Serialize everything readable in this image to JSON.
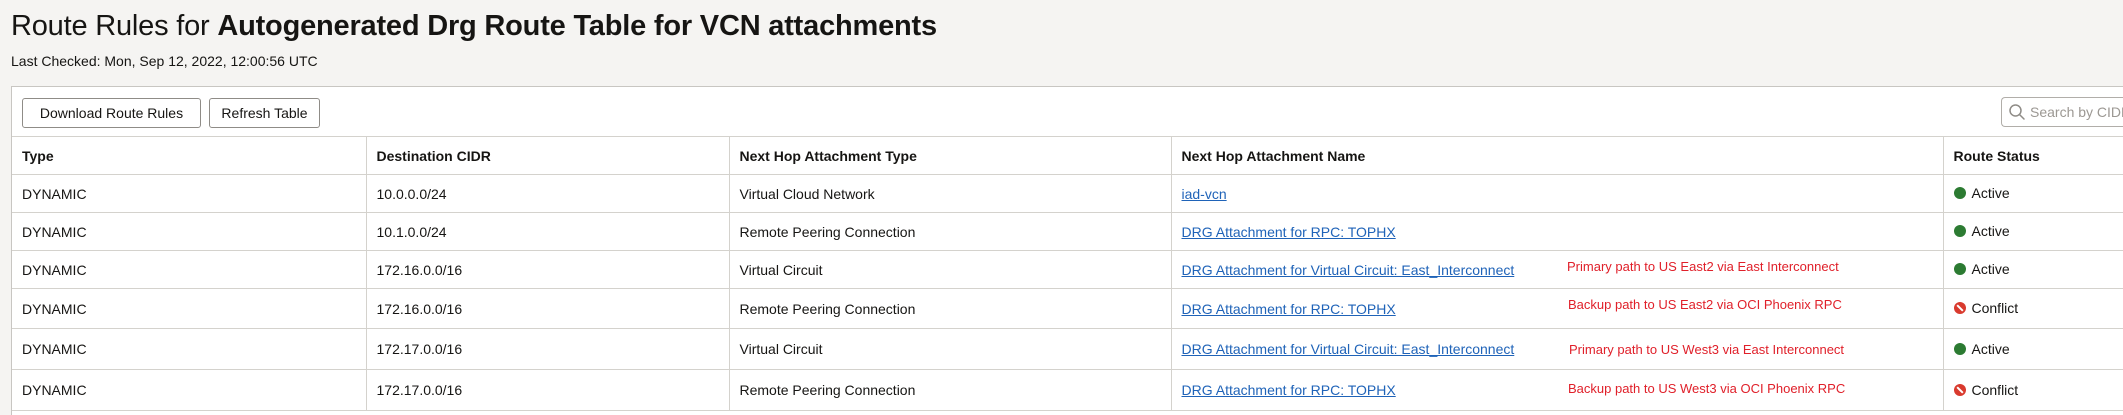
{
  "header": {
    "title_prefix": "Route Rules for ",
    "title_name": "Autogenerated Drg Route Table for VCN attachments",
    "last_checked": "Last Checked: Mon, Sep 12, 2022, 12:00:56 UTC"
  },
  "toolbar": {
    "download_label": "Download Route Rules",
    "refresh_label": "Refresh Table",
    "search_placeholder": "Search by CIDR"
  },
  "table": {
    "columns": [
      "Type",
      "Destination CIDR",
      "Next Hop Attachment Type",
      "Next Hop Attachment Name",
      "Route Status"
    ],
    "rows": [
      {
        "type": "DYNAMIC",
        "cidr": "10.0.0.0/24",
        "attachment_type": "Virtual Cloud Network",
        "attachment_name": "iad-vcn",
        "status": "Active",
        "status_kind": "active"
      },
      {
        "type": "DYNAMIC",
        "cidr": "10.1.0.0/24",
        "attachment_type": "Remote Peering Connection",
        "attachment_name": "DRG Attachment for RPC: TOPHX",
        "status": "Active",
        "status_kind": "active"
      },
      {
        "type": "DYNAMIC",
        "cidr": "172.16.0.0/16",
        "attachment_type": "Virtual Circuit",
        "attachment_name": "DRG Attachment for Virtual Circuit: East_Interconnect",
        "status": "Active",
        "status_kind": "active"
      },
      {
        "type": "DYNAMIC",
        "cidr": "172.16.0.0/16",
        "attachment_type": "Remote Peering Connection",
        "attachment_name": "DRG Attachment for RPC: TOPHX",
        "status": "Conflict",
        "status_kind": "conflict"
      },
      {
        "type": "DYNAMIC",
        "cidr": "172.17.0.0/16",
        "attachment_type": "Virtual Circuit",
        "attachment_name": "DRG Attachment for Virtual Circuit: East_Interconnect",
        "status": "Active",
        "status_kind": "active"
      },
      {
        "type": "DYNAMIC",
        "cidr": "172.17.0.0/16",
        "attachment_type": "Remote Peering Connection",
        "attachment_name": "DRG Attachment for RPC: TOPHX",
        "status": "Conflict",
        "status_kind": "conflict"
      }
    ]
  },
  "annotations": [
    "Primary path to US East2 via East Interconnect",
    "Backup path to US East2 via OCI Phoenix RPC",
    "Primary path to US West3 via East Interconnect",
    "Backup path to US West3 via OCI Phoenix RPC"
  ],
  "colors": {
    "active": "#2c7b32",
    "conflict": "#d93a2e",
    "link": "#1f63b8",
    "annotation": "#e0202a"
  },
  "icons": {
    "search": "search-icon",
    "active_status": "status-active-icon",
    "conflict_status": "status-conflict-icon"
  }
}
